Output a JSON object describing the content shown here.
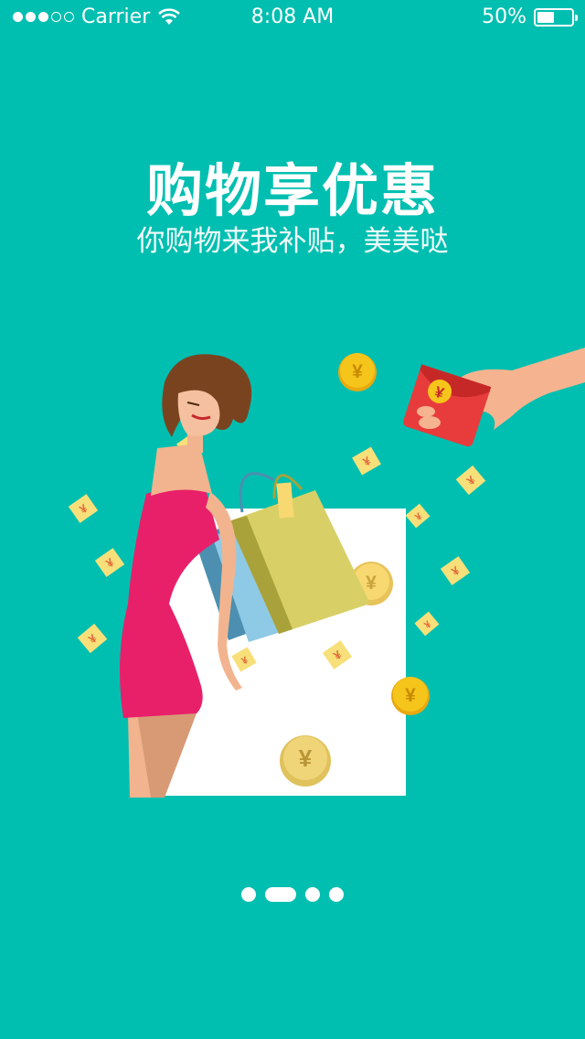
{
  "status_bar": {
    "carrier": "Carrier",
    "time": "8:08 AM",
    "battery": "50%",
    "battery_level": 0.5,
    "signal_bars": 3,
    "signal_total": 5
  },
  "intro": {
    "title": "购物享优惠",
    "subtitle": "你购物来我补贴，美美哒"
  },
  "illustration": {
    "coin_symbol": "¥"
  },
  "pager": {
    "total": 4,
    "active_index": 1
  },
  "colors": {
    "background": "#00bfb0",
    "dress": "#e8206a",
    "coin": "#f5c51b",
    "envelope": "#e83c3c",
    "bill": "#f7e07a"
  }
}
